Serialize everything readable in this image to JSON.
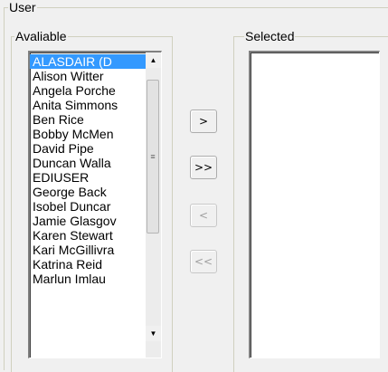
{
  "user_group": {
    "label": "User"
  },
  "available": {
    "label": "Avaliable",
    "items": [
      "ALASDAIR (D",
      "Alison Witter",
      "Angela Porche",
      "Anita Simmons",
      "Ben Rice",
      "Bobby McMen",
      "David Pipe",
      "Duncan Walla",
      "EDIUSER",
      "George Back",
      "Isobel Duncar",
      "Jamie Glasgov",
      "Karen Stewart",
      "Kari McGillivra",
      "Katrina Reid",
      "Marlun Imlau"
    ],
    "selected_item": "ALASDAIR (D"
  },
  "selected": {
    "label": "Selected",
    "items": []
  },
  "buttons": {
    "add": ">",
    "add_all": ">>",
    "remove": "<",
    "remove_all": "<<"
  }
}
